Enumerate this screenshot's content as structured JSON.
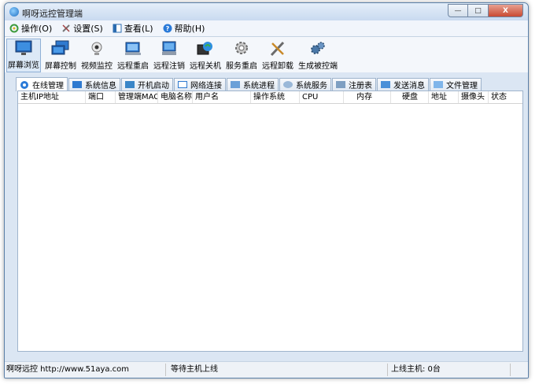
{
  "window": {
    "title": "啊呀远控管理端",
    "buttons": {
      "minimize": "—",
      "maximize": "□",
      "close": "X"
    }
  },
  "menu": [
    {
      "label": "操作(O)",
      "icon": "gear-refresh-icon"
    },
    {
      "label": "设置(S)",
      "icon": "tools-icon"
    },
    {
      "label": "查看(L)",
      "icon": "view-icon"
    },
    {
      "label": "帮助(H)",
      "icon": "help-icon"
    }
  ],
  "toolbar": [
    {
      "label": "屏幕浏览",
      "icon": "monitor-icon",
      "active": true
    },
    {
      "label": "屏幕控制",
      "icon": "monitor-control-icon"
    },
    {
      "label": "视频监控",
      "icon": "webcam-icon"
    },
    {
      "label": "远程重启",
      "icon": "restart-icon"
    },
    {
      "label": "远程注销",
      "icon": "logoff-icon"
    },
    {
      "label": "远程关机",
      "icon": "shutdown-icon"
    },
    {
      "label": "服务重启",
      "icon": "service-icon"
    },
    {
      "label": "远程卸载",
      "icon": "uninstall-icon"
    },
    {
      "label": "生成被控端",
      "icon": "build-icon"
    }
  ],
  "tabs": [
    {
      "label": "在线管理",
      "active": true
    },
    {
      "label": "系统信息"
    },
    {
      "label": "开机启动"
    },
    {
      "label": "网络连接"
    },
    {
      "label": "系统进程"
    },
    {
      "label": "系统服务"
    },
    {
      "label": "注册表"
    },
    {
      "label": "发送消息"
    },
    {
      "label": "文件管理"
    }
  ],
  "table": {
    "columns": [
      "主机IP地址",
      "端口",
      "管理端MAC",
      "电脑名称",
      "用户名",
      "操作系统",
      "CPU",
      "内存",
      "硬盘",
      "地址",
      "摄像头",
      "状态"
    ],
    "rows": []
  },
  "status": {
    "site": "啊呀远控 http://www.51aya.com",
    "waiting": "等待主机上线",
    "online": "上线主机: 0台"
  },
  "colors": {
    "accent": "#1e6fc2",
    "close_red": "#c94a32",
    "frame": "#dbe6f3"
  }
}
